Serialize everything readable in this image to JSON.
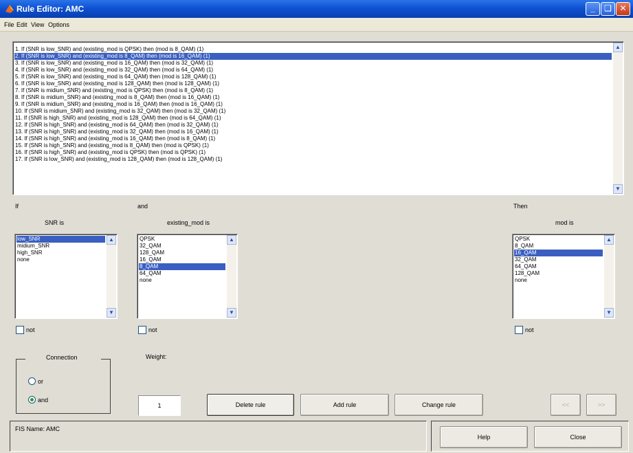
{
  "window": {
    "title": "Rule Editor: AMC"
  },
  "menu": [
    "File",
    "Edit",
    "View",
    "Options"
  ],
  "rules": [
    "1. If (SNR is low_SNR) and (existing_mod is QPSK) then (mod is 8_QAM) (1)",
    "2. If (SNR is low_SNR) and (existing_mod is 8_QAM) then (mod is 16_QAM) (1)",
    "3. If (SNR is low_SNR) and (existing_mod is 16_QAM) then (mod is 32_QAM) (1)",
    "4. If (SNR is low_SNR) and (existing_mod is 32_QAM) then (mod is 64_QAM) (1)",
    "5. If (SNR is low_SNR) and (existing_mod is 64_QAM) then (mod is 128_QAM) (1)",
    "6. If (SNR is low_SNR) and (existing_mod is 128_QAM) then (mod is 128_QAM) (1)",
    "7. If (SNR is midium_SNR) and (existing_mod is QPSK) then (mod is 8_QAM) (1)",
    "8. If (SNR is midium_SNR) and (existing_mod is 8_QAM) then (mod is 16_QAM) (1)",
    "9. If (SNR is midium_SNR) and (existing_mod is 16_QAM) then (mod is 16_QAM) (1)",
    "10. If (SNR is midium_SNR) and (existing_mod is 32_QAM) then (mod is 32_QAM) (1)",
    "11. If (SNR is high_SNR) and (existing_mod is 128_QAM) then (mod is 64_QAM) (1)",
    "12. If (SNR is high_SNR) and (existing_mod is 64_QAM) then (mod is 32_QAM) (1)",
    "13. If (SNR is high_SNR) and (existing_mod is 32_QAM) then (mod is 16_QAM) (1)",
    "14. If (SNR is high_SNR) and (existing_mod is 16_QAM) then (mod is 8_QAM) (1)",
    "15. If (SNR is high_SNR) and (existing_mod is 8_QAM) then (mod is QPSK) (1)",
    "16. If (SNR is high_SNR) and (existing_mod is QPSK) then (mod is QPSK) (1)",
    "17. If (SNR is low_SNR) and (existing_mod is 128_QAM) then (mod is 128_QAM) (1)"
  ],
  "selected_rule": 1,
  "if_label": "If",
  "and_label": "and",
  "then_label": "Then",
  "snr": {
    "title": "SNR is",
    "items": [
      "low_SNR",
      "midium_SNR",
      "high_SNR",
      "none"
    ],
    "selected": 0,
    "not_label": "not"
  },
  "existing_mod": {
    "title": "existing_mod is",
    "items": [
      "QPSK",
      "32_QAM",
      "128_QAM",
      "16_QAM",
      "8_QAM",
      "64_QAM",
      "none"
    ],
    "selected": 4,
    "not_label": "not"
  },
  "mod": {
    "title": "mod is",
    "items": [
      "QPSK",
      "8_QAM",
      "16_QAM",
      "32_QAM",
      "64_QAM",
      "128_QAM",
      "none"
    ],
    "selected": 2,
    "not_label": "not"
  },
  "connection": {
    "title": "Connection",
    "or_label": "or",
    "and_label": "and",
    "selected": "and"
  },
  "weight": {
    "label": "Weight:",
    "value": "1"
  },
  "buttons": {
    "delete": "Delete rule",
    "add": "Add rule",
    "change": "Change rule",
    "prev": "<<",
    "next": ">>",
    "help": "Help",
    "close": "Close"
  },
  "status": {
    "fis_name": "FIS Name: AMC"
  }
}
